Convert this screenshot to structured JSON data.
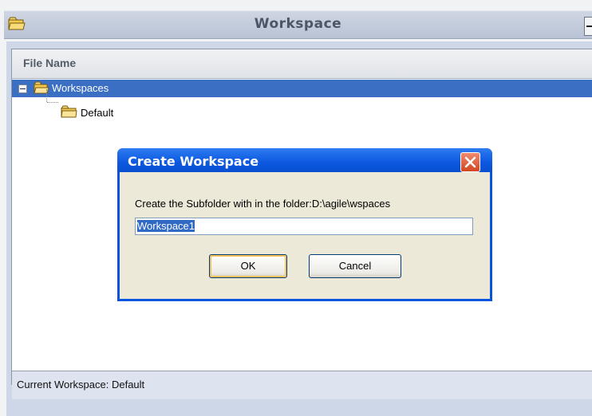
{
  "window": {
    "title": "Workspace",
    "minimize_icon": "minimize-icon"
  },
  "table": {
    "column_header": "File Name"
  },
  "tree": {
    "root_label": "Workspaces",
    "child_label": "Default",
    "expander_icon": "collapse-icon",
    "folder_icon": "folder-icon"
  },
  "status_bar": {
    "text": "Current Workspace: Default"
  },
  "dialog": {
    "title": "Create Workspace",
    "message": "Create the Subfolder with in the folder:D:\\agile\\wspaces",
    "input_value": "Workspace1",
    "ok_label": "OK",
    "cancel_label": "Cancel",
    "close_icon": "close-icon"
  },
  "colors": {
    "selection": "#3a6fc4",
    "dialog_title": "#0b58e0",
    "panel_bg": "#cdd7e7"
  }
}
